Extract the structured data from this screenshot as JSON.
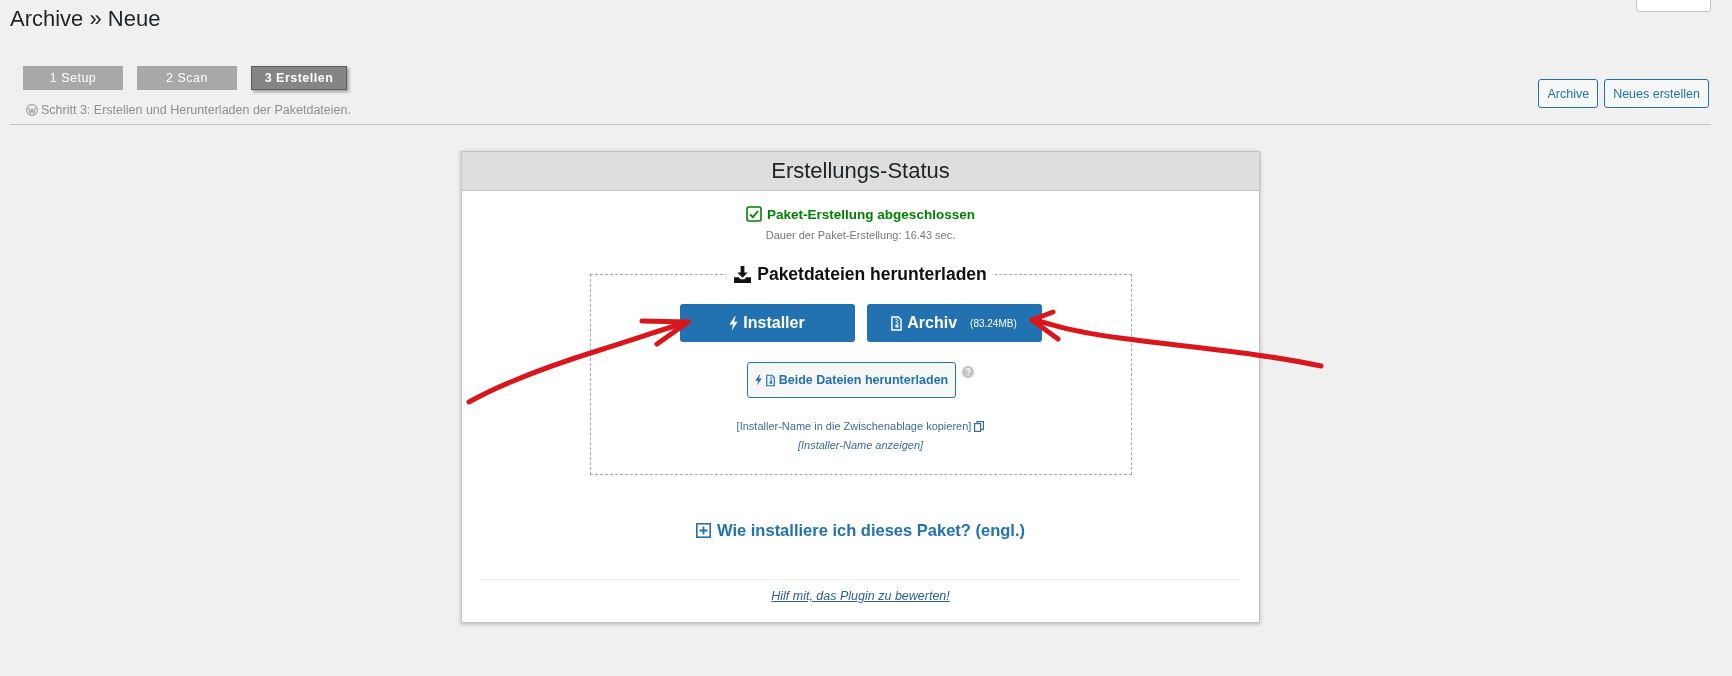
{
  "page": {
    "title": "Archive » Neue"
  },
  "steps": [
    {
      "label": "1 Setup",
      "selected": false
    },
    {
      "label": "2 Scan",
      "selected": false
    },
    {
      "label": "3 Erstellen",
      "selected": true
    }
  ],
  "step_hint": "Schritt 3: Erstellen und Herunterladen der Paketdateien.",
  "header_buttons": [
    "Archive",
    "Neues erstellen"
  ],
  "card": {
    "title": "Erstellungs-Status",
    "status": {
      "text": "Paket-Erstellung abgeschlossen",
      "duration": "Dauer der Paket-Erstellung: 16.43 sec."
    },
    "downloads": {
      "title": "Paketdateien herunterladen",
      "buttons": [
        {
          "kind": "installer",
          "label": "Installer"
        },
        {
          "kind": "archive",
          "label": "Archiv",
          "size": "(83.24MB)"
        }
      ],
      "both_button": "Beide Dateien herunterladen",
      "copy_link": "[Installer-Name in die Zwischenablage kopieren]",
      "show_link": "[Installer-Name anzeigen]"
    },
    "help_link": "Wie installiere ich dieses Paket? (engl.)",
    "footer_link": "Hilf mit, das Plugin zu bewerten!"
  },
  "annotations": [
    {
      "kind": "arrow"
    },
    {
      "kind": "arrow"
    }
  ]
}
